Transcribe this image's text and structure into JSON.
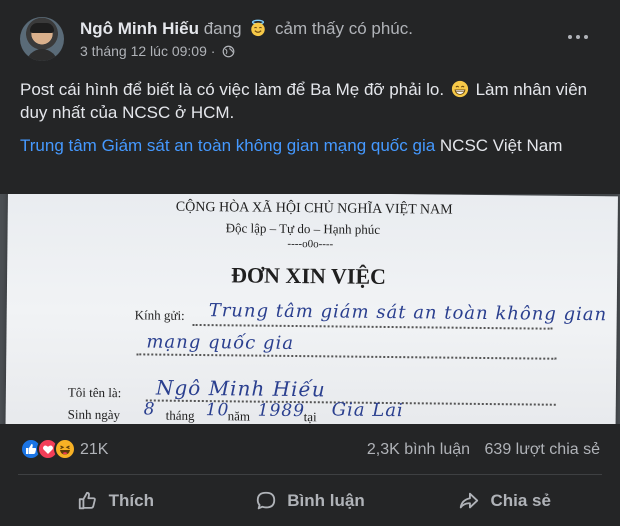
{
  "post": {
    "author_name": "Ngô Minh Hiếu",
    "feeling_prefix": "đang",
    "feeling_text": "cảm thấy có phúc.",
    "feeling_icon": "halo-smile-emoji",
    "timestamp": "3 tháng 12 lúc 09:09",
    "dot_separator": "·",
    "audience_icon": "globe-icon",
    "text_before_emoji": "Post cái hình để biết là có việc làm để Ba Mẹ đỡ phải lo.",
    "text_emoji": "grinning-face-emoji",
    "text_after_emoji": "Làm nhân viên duy nhất của NCSC ở HCM.",
    "tag_link": "Trung tâm Giám sát an toàn không gian mạng quốc gia",
    "tag_rest": "NCSC Việt Nam"
  },
  "photo": {
    "header_line1": "CỘNG HÒA XÃ HỘI CHỦ NGHĨA VIỆT NAM",
    "header_line2": "Độc lập – Tự do – Hạnh phúc",
    "header_line3": "----o0o----",
    "doc_title": "ĐƠN XIN VIỆC",
    "to_label": "Kính gửi:",
    "to_hand_line1": "Trung tâm giám sát an toàn không gian",
    "to_hand_line2": "mạng quốc gia",
    "name_label": "Tôi tên là:",
    "name_hand": "Ngô Minh Hiếu",
    "dob_label": "Sinh ngày",
    "dob_day": "8",
    "dob_month_label": "tháng",
    "dob_month": "10",
    "dob_year_label": "năm",
    "dob_year": "1989",
    "place_label": "tại",
    "place_hand": "Gia Lai"
  },
  "engagement": {
    "reaction_icons": [
      "like-reaction-icon",
      "love-reaction-icon",
      "haha-reaction-icon"
    ],
    "reaction_count": "21K",
    "comments": "2,3K bình luận",
    "shares": "639 lượt chia sẻ"
  },
  "actions": {
    "like_label": "Thích",
    "comment_label": "Bình luận",
    "share_label": "Chia sẻ"
  },
  "colors": {
    "background": "#242526",
    "primary_text": "#e4e6eb",
    "secondary_text": "#b0b3b8",
    "link": "#4599ff",
    "like_blue": "#1b74e4",
    "love_red": "#f33e58",
    "haha_yellow": "#f7b125"
  }
}
